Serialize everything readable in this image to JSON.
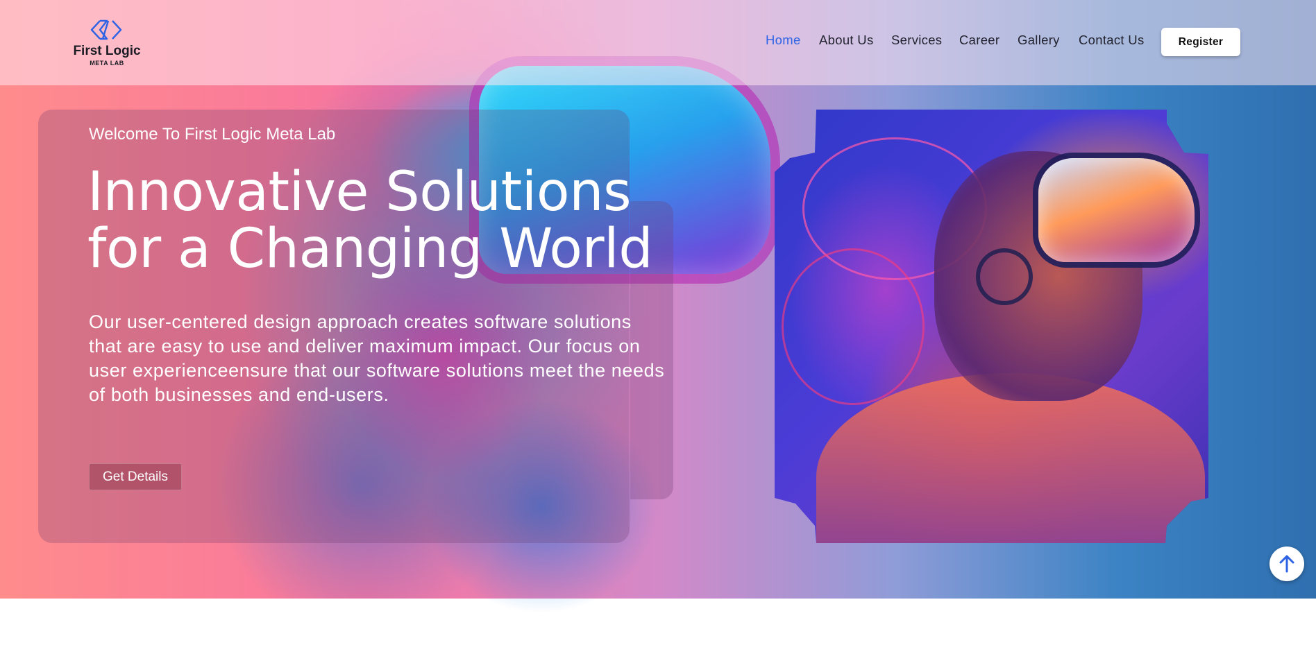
{
  "brand": {
    "name": "First Logic",
    "tagline": "META LAB",
    "logo_icon": "code-brackets-icon",
    "accent_color": "#2e63e6"
  },
  "nav": {
    "items": [
      {
        "label": "Home",
        "active": true
      },
      {
        "label": "About Us",
        "active": false
      },
      {
        "label": "Services",
        "active": false
      },
      {
        "label": "Career",
        "active": false
      },
      {
        "label": "Gallery",
        "active": false
      },
      {
        "label": "Contact Us",
        "active": false
      }
    ],
    "register_label": "Register"
  },
  "hero": {
    "welcome": "Welcome To First Logic Meta Lab",
    "headline_line1": "Innovative Solutions",
    "headline_line2": "for a Changing World",
    "description": "Our user-centered design approach creates software solutions that are easy to use and deliver maximum impact. Our focus on user experienceensure that our software solutions meet the needs of both businesses and end-users.",
    "cta_label": "Get Details"
  },
  "scroll_top": {
    "icon": "arrow-up-icon"
  }
}
